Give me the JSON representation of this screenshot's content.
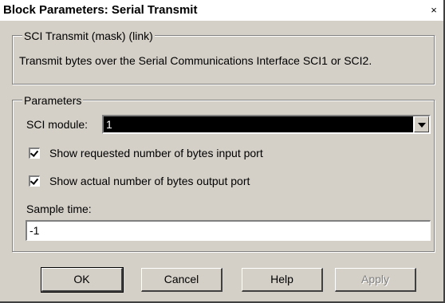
{
  "window": {
    "title": "Block Parameters: Serial Transmit",
    "close_glyph": "×"
  },
  "mask_group": {
    "legend": "SCI Transmit (mask) (link)",
    "description": "Transmit bytes over the Serial Communications Interface SCI1 or SCI2."
  },
  "parameters": {
    "legend": "Parameters",
    "sci_module_label": "SCI module:",
    "sci_module_value": "1",
    "show_requested_label": "Show requested number of bytes input port",
    "show_requested_checked": true,
    "show_actual_label": "Show actual number of bytes output port",
    "show_actual_checked": true,
    "sample_time_label": "Sample time:",
    "sample_time_value": "-1"
  },
  "buttons": {
    "ok": "OK",
    "cancel": "Cancel",
    "help": "Help",
    "apply": "Apply"
  }
}
